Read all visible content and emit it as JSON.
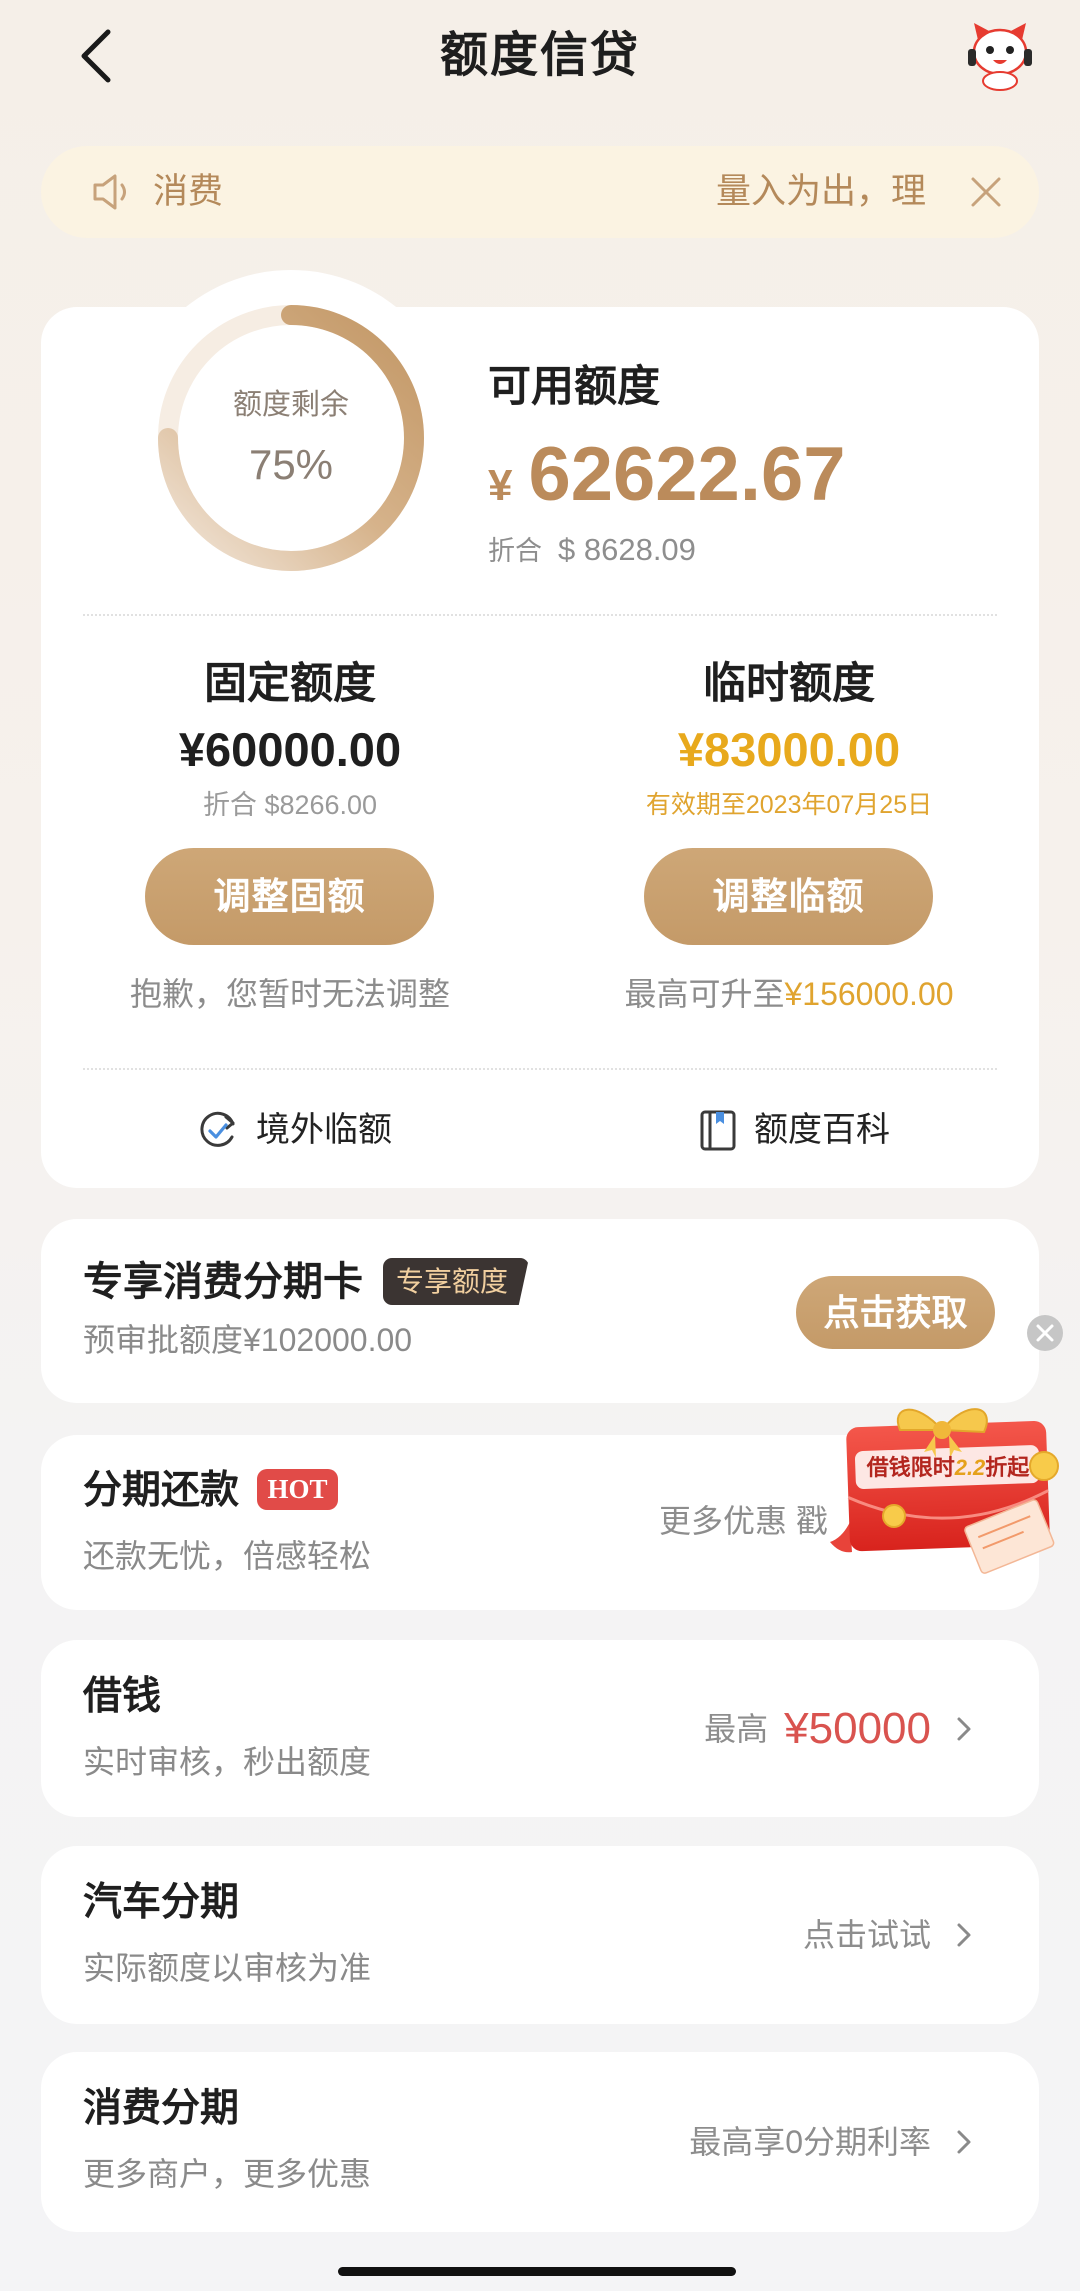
{
  "header": {
    "title": "额度信贷",
    "back_icon": "back-arrow-icon",
    "mascot_icon": "mascot-icon"
  },
  "notice": {
    "icon": "speaker-icon",
    "label": "消费",
    "text": "量入为出，理",
    "close_icon": "close-icon"
  },
  "credit": {
    "ring_label": "额度剩余",
    "ring_percent_label": "75%",
    "remaining_fraction": 0.75,
    "available_label": "可用额度",
    "currency_symbol": "¥",
    "available_amount": "62622.67",
    "converted_label": "折合",
    "converted_amount": "$ 8628.09",
    "fixed": {
      "title": "固定额度",
      "amount": "¥60000.00",
      "sub": "折合 $8266.00",
      "button": "调整固额",
      "note": "抱歉，您暂时无法调整"
    },
    "temporary": {
      "title": "临时额度",
      "amount": "¥83000.00",
      "sub": "有效期至2023年07月25日",
      "button": "调整临额",
      "note_prefix": "最高可升至",
      "note_highlight": "¥156000.00"
    },
    "links": [
      {
        "label": "境外临额",
        "icon": "overseas-limit-icon"
      },
      {
        "label": "额度百科",
        "icon": "book-icon"
      }
    ]
  },
  "promo": {
    "title": "专享消费分期卡",
    "badge": "专享额度",
    "subtitle": "预审批额度¥102000.00",
    "button": "点击获取",
    "dismiss_icon": "close-circle-icon"
  },
  "floating_promo": {
    "prefix": "借钱限时",
    "highlight": "2.2",
    "suffix": "折起",
    "icon": "red-envelope-icon"
  },
  "list": [
    {
      "title": "分期还款",
      "tag": "HOT",
      "subtitle": "还款无忧，倍感轻松",
      "right": "更多优惠 戳"
    },
    {
      "title": "借钱",
      "subtitle": "实时审核，秒出额度",
      "right_prefix": "最高",
      "right": "¥50000"
    },
    {
      "title": "汽车分期",
      "subtitle": "实际额度以审核为准",
      "right": "点击试试"
    },
    {
      "title": "消费分期",
      "subtitle": "更多商户，更多优惠",
      "right": "最高享0分期利率"
    }
  ],
  "colors": {
    "accent_tan": "#c9a06e",
    "amount_tan": "#bb8b5b",
    "gold": "#e8a91c",
    "red": "#d9534f",
    "hot_red": "#e14b48",
    "notice_bg": "#fbf3e2",
    "badge_dark": "#3b3432"
  }
}
